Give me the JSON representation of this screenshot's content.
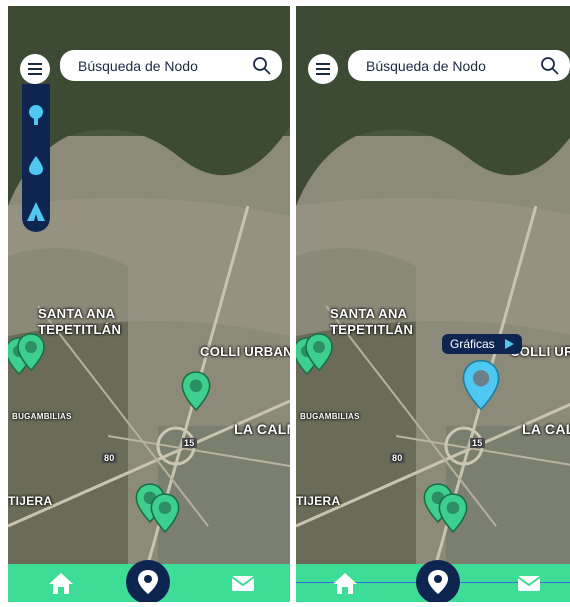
{
  "search": {
    "placeholder": "Búsqueda de Nodo"
  },
  "map": {
    "labels": {
      "santa_ana": "SANTA ANA",
      "tepetitlan": "TEPETITLÁN",
      "colli_urban": "COLLI URBAN",
      "colli_urba": "COLLI URBA",
      "bugambilias": "BUGAMBILIAS",
      "la_calma": "LA CALM",
      "tijera": "TIJERA",
      "road_80": "80",
      "road_15": "15"
    }
  },
  "tooltip": {
    "label": "Gráficas"
  },
  "colors": {
    "nav_green": "#3ddc97",
    "navy": "#0d2550",
    "pin_green": "#3ecf8e",
    "pin_blue": "#4ec8f0"
  },
  "icons": [
    "menu-icon",
    "search-icon",
    "tree-icon",
    "water-drop-icon",
    "tent-icon",
    "map-pin-icon",
    "home-icon",
    "location-icon",
    "mail-icon"
  ]
}
